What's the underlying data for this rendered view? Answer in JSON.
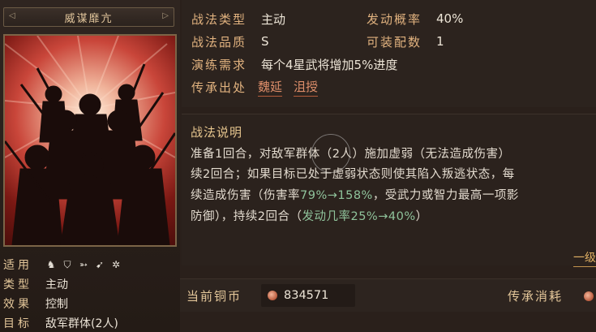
{
  "skill": {
    "title": "威谋靡亢",
    "attributes": {
      "applicable": {
        "label": "适用",
        "icons": [
          "horse-icon",
          "shield-icon",
          "bow-icon",
          "spear-icon",
          "wheel-icon"
        ]
      },
      "type": {
        "label": "类型",
        "value": "主动"
      },
      "effect": {
        "label": "效果",
        "value": "控制"
      },
      "target": {
        "label": "目标",
        "value": "敌军群体(2人)"
      }
    }
  },
  "info": {
    "skill_type_label": "战法类型",
    "skill_type_value": "主动",
    "trigger_rate_label": "发动概率",
    "trigger_rate_value": "40%",
    "quality_label": "战法品质",
    "quality_value": "S",
    "equippable_label": "可装配数",
    "equippable_value": "1",
    "practice_label": "演练需求",
    "practice_value": "每个4星武将增加5%进度",
    "source_label": "传承出处",
    "sources": [
      "魏延",
      "沮授"
    ]
  },
  "description": {
    "title": "战法说明",
    "line1": "准备1回合，对敌军群体（2人）施加虚弱（无法造成伤害）",
    "line2": "续2回合；如果目标已处于虚弱状态则使其陷入叛逃状态，每",
    "line3_a": "续造成伤害（伤害率",
    "line3_hl": "79%→158%",
    "line3_b": "，受武力或智力最高一项影",
    "line4_a": "防御），持续2回合（",
    "line4_hl": "发动几率25%→40%",
    "line4_b": "）",
    "rank_link": "一级"
  },
  "footer": {
    "coin_label": "当前铜币",
    "coin_value": "834571",
    "inherit_label": "传承消耗"
  }
}
